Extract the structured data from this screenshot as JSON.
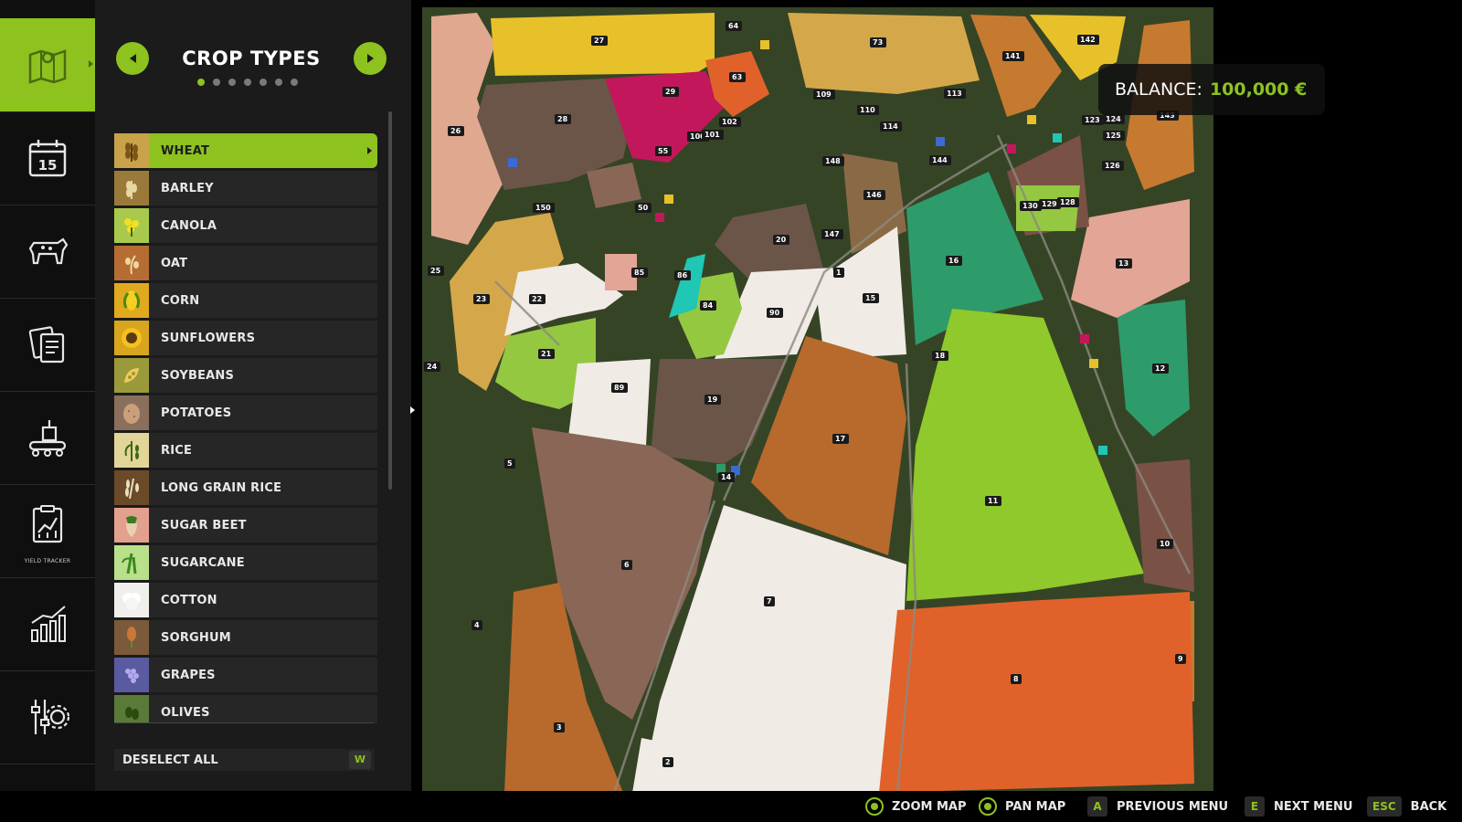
{
  "rail": {
    "items": [
      {
        "name": "map-icon",
        "active": true
      },
      {
        "name": "calendar-icon",
        "calendar_day": "15"
      },
      {
        "name": "animals-icon"
      },
      {
        "name": "contracts-icon"
      },
      {
        "name": "production-icon"
      },
      {
        "name": "yield-tracker-icon",
        "caption": "YIELD TRACKER"
      },
      {
        "name": "statistics-icon"
      },
      {
        "name": "settings-icon"
      }
    ]
  },
  "panel": {
    "title": "CROP TYPES",
    "page_count": 7,
    "active_page": 0,
    "crops": [
      {
        "label": "WHEAT",
        "icon": "wheat-icon",
        "color": "#c9a24a",
        "selected": true
      },
      {
        "label": "BARLEY",
        "icon": "barley-icon",
        "color": "#9a7a3a"
      },
      {
        "label": "CANOLA",
        "icon": "canola-icon",
        "color": "#a9c94c"
      },
      {
        "label": "OAT",
        "icon": "oat-icon",
        "color": "#b56d33"
      },
      {
        "label": "CORN",
        "icon": "corn-icon",
        "color": "#e1a91e"
      },
      {
        "label": "SUNFLOWERS",
        "icon": "sunflower-icon",
        "color": "#d9a51e"
      },
      {
        "label": "SOYBEANS",
        "icon": "soybean-icon",
        "color": "#9a9a3a"
      },
      {
        "label": "POTATOES",
        "icon": "potato-icon",
        "color": "#8a6f5c"
      },
      {
        "label": "RICE",
        "icon": "rice-icon",
        "color": "#e3d59a"
      },
      {
        "label": "LONG GRAIN RICE",
        "icon": "long-grain-rice-icon",
        "color": "#6b4a2a"
      },
      {
        "label": "SUGAR BEET",
        "icon": "sugar-beet-icon",
        "color": "#e3a08e"
      },
      {
        "label": "SUGARCANE",
        "icon": "sugarcane-icon",
        "color": "#b9e08a"
      },
      {
        "label": "COTTON",
        "icon": "cotton-icon",
        "color": "#f0efec"
      },
      {
        "label": "SORGHUM",
        "icon": "sorghum-icon",
        "color": "#7a5a3a"
      },
      {
        "label": "GRAPES",
        "icon": "grapes-icon",
        "color": "#5a5aa0"
      },
      {
        "label": "OLIVES",
        "icon": "olives-icon",
        "color": "#5a7a3a"
      }
    ],
    "deselect_label": "DESELECT ALL",
    "deselect_key": "W"
  },
  "balance": {
    "label": "BALANCE:",
    "value": "100,000 €"
  },
  "map": {
    "field_numbers": [
      "1",
      "2",
      "3",
      "4",
      "5",
      "6",
      "7",
      "8",
      "9",
      "10",
      "11",
      "12",
      "13",
      "14",
      "15",
      "16",
      "17",
      "18",
      "19",
      "20",
      "21",
      "22",
      "23",
      "24",
      "25",
      "26",
      "27",
      "28",
      "29",
      "50",
      "55",
      "63",
      "64",
      "73",
      "84",
      "85",
      "86",
      "89",
      "90",
      "100",
      "101",
      "102",
      "109",
      "110",
      "113",
      "114",
      "123",
      "124",
      "125",
      "126",
      "128",
      "129",
      "130",
      "141",
      "142",
      "143",
      "144",
      "146",
      "147",
      "148",
      "150"
    ]
  },
  "bottom_bar": {
    "hints": [
      {
        "key": "",
        "label": "ZOOM MAP",
        "icon": "left-stick-icon"
      },
      {
        "key": "",
        "label": "PAN MAP",
        "icon": "right-stick-icon"
      },
      {
        "key": "A",
        "label": "PREVIOUS MENU"
      },
      {
        "key": "E",
        "label": "NEXT MENU"
      },
      {
        "key": "ESC",
        "label": "BACK"
      }
    ]
  }
}
